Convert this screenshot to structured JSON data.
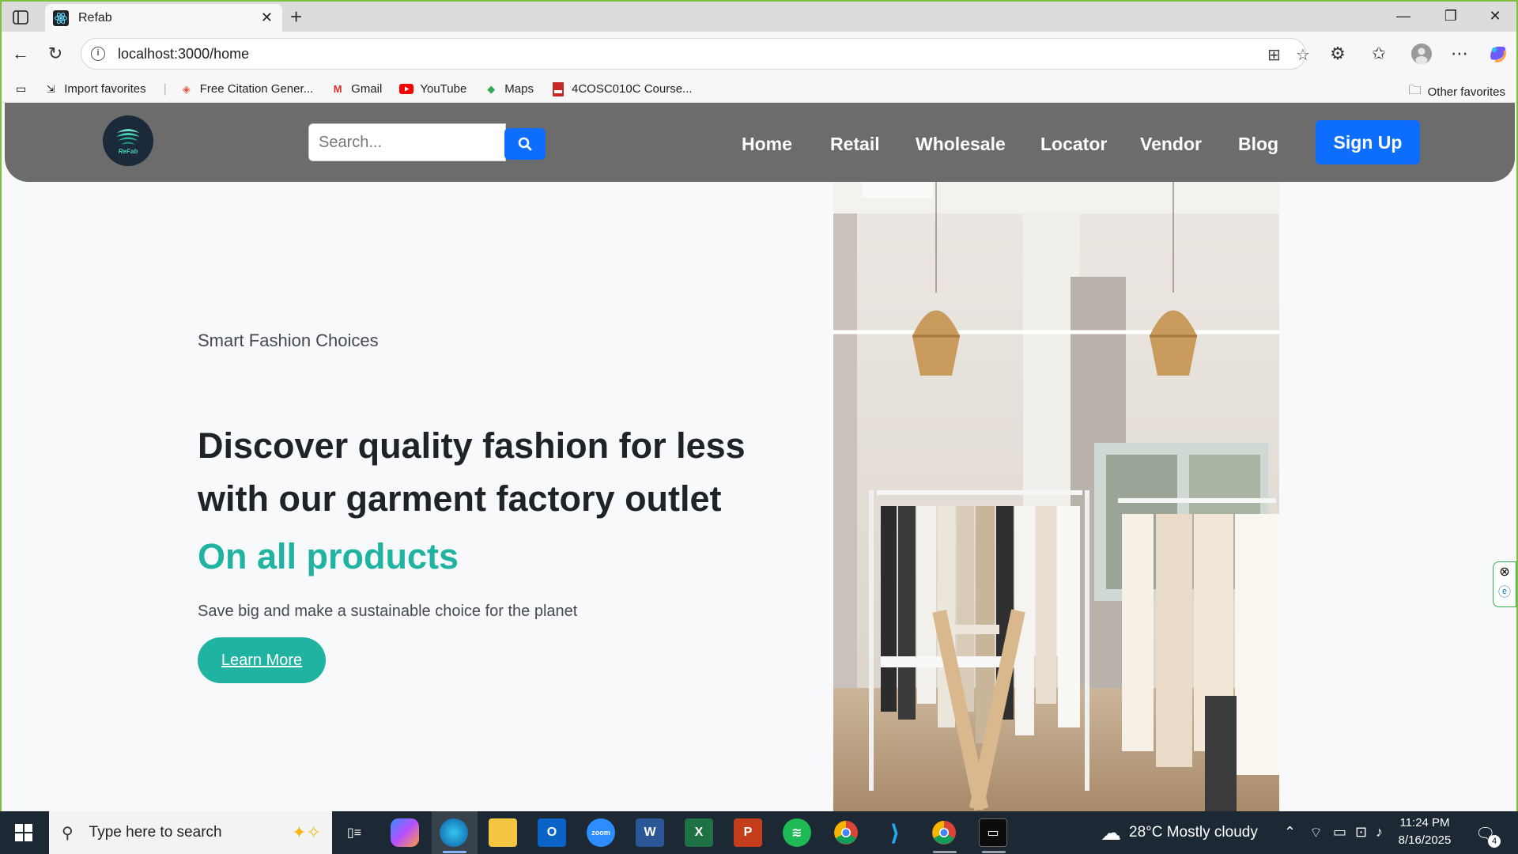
{
  "browser": {
    "tab_title": "Refab",
    "url": "localhost:3000/home",
    "favorites": [
      {
        "label": "Import favorites",
        "icon": "import-icon"
      },
      {
        "label": "Free Citation Gener...",
        "icon": "citation-icon"
      },
      {
        "label": "Gmail",
        "icon": "gmail-icon"
      },
      {
        "label": "YouTube",
        "icon": "youtube-icon"
      },
      {
        "label": "Maps",
        "icon": "maps-icon"
      },
      {
        "label": "4COSC010C Course...",
        "icon": "pdf-icon"
      }
    ],
    "other_favorites": "Other favorites"
  },
  "site": {
    "logo_text": "ReFab",
    "search_placeholder": "Search...",
    "menu": [
      "Home",
      "Retail",
      "Wholesale",
      "Locator",
      "Vendor",
      "Blog"
    ],
    "signup": "Sign Up",
    "accent_color": "#21b3a1",
    "primary_color": "#0d6efd"
  },
  "hero": {
    "kicker": "Smart Fashion Choices",
    "title": "Discover quality fashion for less with our garment factory outlet",
    "accent": "On all products",
    "subtitle": "Save big and make a sustainable choice for the planet",
    "button": "Learn More"
  },
  "taskbar": {
    "search_placeholder": "Type here to search",
    "weather": "28°C  Mostly cloudy",
    "time": "11:24 PM",
    "date": "8/16/2025",
    "notification_count": "4"
  }
}
